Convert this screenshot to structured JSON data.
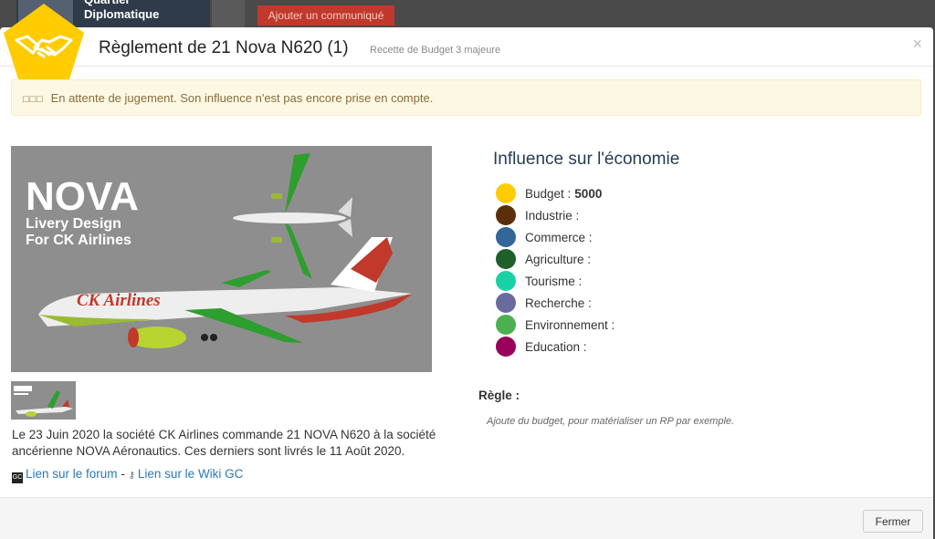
{
  "background": {
    "card_title": "Quartier\nDiplomatique",
    "action_button": "Ajouter un communiqué"
  },
  "modal": {
    "title": "Règlement de 21 Nova N620 (1)",
    "subtitle": "Recette de Budget 3 majeure",
    "close_glyph": "×",
    "icon": "handshake-icon"
  },
  "alert": {
    "glyphs": "□□□",
    "text": "En attente de jugement. Son influence n'est pas encore prise en compte."
  },
  "image": {
    "brand": "NOVA",
    "line1": "Livery Design",
    "line2": "For CK Airlines",
    "fuselage_text": "CK Airlines"
  },
  "description": "Le 23 Juin 2020 la société CK Airlines commande 21 NOVA N620 à la société ancérienne NOVA Aéronautics. Ces derniers sont livrés le 11 Août 2020.",
  "links": {
    "forum_icon_text": "GC",
    "forum": "Lien sur le forum",
    "separator": "-",
    "wiki": "Lien sur le Wiki GC"
  },
  "influence": {
    "title": "Influence sur l'économie",
    "items": [
      {
        "label": "Budget :",
        "value": "5000",
        "color": "#ffcc00"
      },
      {
        "label": "Industrie :",
        "value": "",
        "color": "#5c2e0b"
      },
      {
        "label": "Commerce :",
        "value": "",
        "color": "#336699"
      },
      {
        "label": "Agriculture :",
        "value": "",
        "color": "#1e5f2a"
      },
      {
        "label": "Tourisme :",
        "value": "",
        "color": "#1ad1a5"
      },
      {
        "label": "Recherche :",
        "value": "",
        "color": "#6a6aa0"
      },
      {
        "label": "Environnement :",
        "value": "",
        "color": "#4caf50"
      },
      {
        "label": "Education :",
        "value": "",
        "color": "#99005c"
      }
    ]
  },
  "rule": {
    "label": "Règle :",
    "text": "Ajoute du budget, pour matérialiser un RP par exemple."
  },
  "footer": {
    "close_button": "Fermer"
  }
}
